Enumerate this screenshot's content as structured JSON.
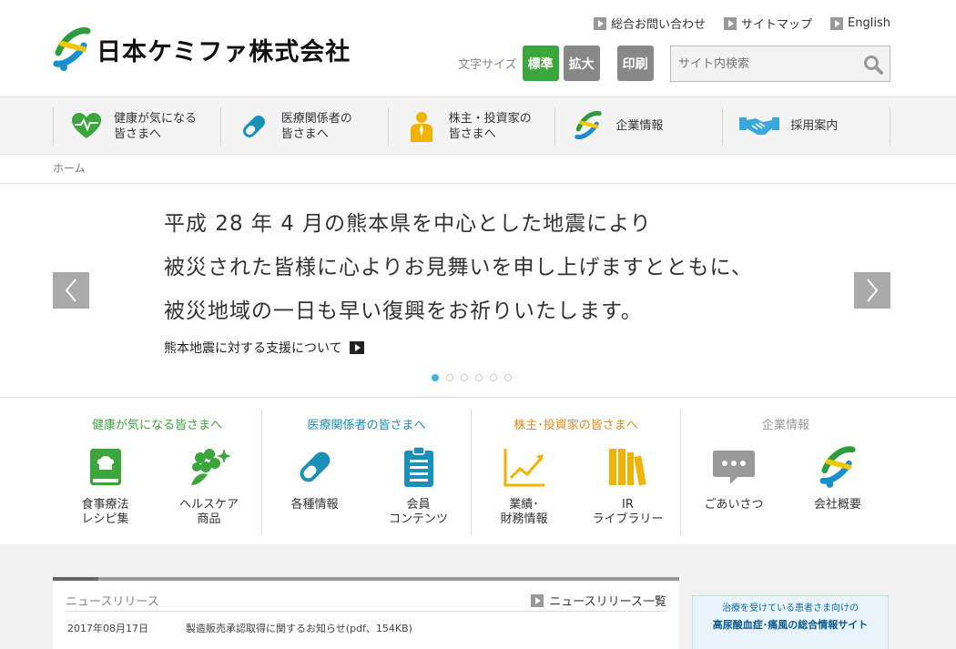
{
  "header": {
    "company_name": "日本ケミファ株式会社",
    "util_links": [
      {
        "label": "総合お問い合わせ"
      },
      {
        "label": "サイトマップ"
      },
      {
        "label": "English"
      }
    ],
    "font_size_label": "文字サイズ",
    "font_std": "標準",
    "font_large": "拡大",
    "print": "印刷",
    "search_placeholder": "サイト内検索"
  },
  "gnav": [
    {
      "line1": "健康が気になる",
      "line2": "皆さまへ",
      "icon": "heart-pulse-icon"
    },
    {
      "line1": "医療関係者の",
      "line2": "皆さまへ",
      "icon": "capsule-icon"
    },
    {
      "line1": "株主・投資家の",
      "line2": "皆さまへ",
      "icon": "person-icon"
    },
    {
      "line1": "企業情報",
      "line2": "",
      "icon": "company-logo-icon"
    },
    {
      "line1": "採用案内",
      "line2": "",
      "icon": "handshake-icon"
    }
  ],
  "breadcrumb": "ホーム",
  "hero": {
    "lines": [
      "平成 28 年 4 月の熊本県を中心とした地震により",
      "被災された皆様に心よりお見舞いを申し上げますとともに、",
      "被災地域の一日も早い復興をお祈りいたします。"
    ],
    "link": "熊本地震に対する支援について",
    "slide_count": 6,
    "active_slide": 1
  },
  "categories": [
    {
      "title": "健康が気になる皆さまへ",
      "color": "#3aa63c",
      "items": [
        {
          "l1": "食事療法",
          "l2": "レシピ集"
        },
        {
          "l1": "ヘルスケア",
          "l2": "商品"
        }
      ]
    },
    {
      "title": "医療関係者の皆さまへ",
      "color": "#1a8fb8",
      "items": [
        {
          "l1": "各種情報",
          "l2": ""
        },
        {
          "l1": "会員",
          "l2": "コンテンツ"
        }
      ]
    },
    {
      "title": "株主･投資家の皆さまへ",
      "color": "#e58a14",
      "items": [
        {
          "l1": "業績･",
          "l2": "財務情報"
        },
        {
          "l1": "IR",
          "l2": "ライブラリー"
        }
      ]
    },
    {
      "title": "企業情報",
      "color": "#999999",
      "items": [
        {
          "l1": "ごあいさつ",
          "l2": ""
        },
        {
          "l1": "会社概要",
          "l2": ""
        }
      ]
    }
  ],
  "news": {
    "title": "ニュースリリース",
    "more": "ニュースリリース一覧",
    "items": [
      {
        "date": "2017年08月17日",
        "text": "製造販売承認取得に関するお知らせ(pdf、154KB)"
      }
    ]
  },
  "banner": {
    "line1": "治療を受けている患者さま向けの",
    "line2": "高尿酸血症･痛風の総合情報サイト"
  }
}
